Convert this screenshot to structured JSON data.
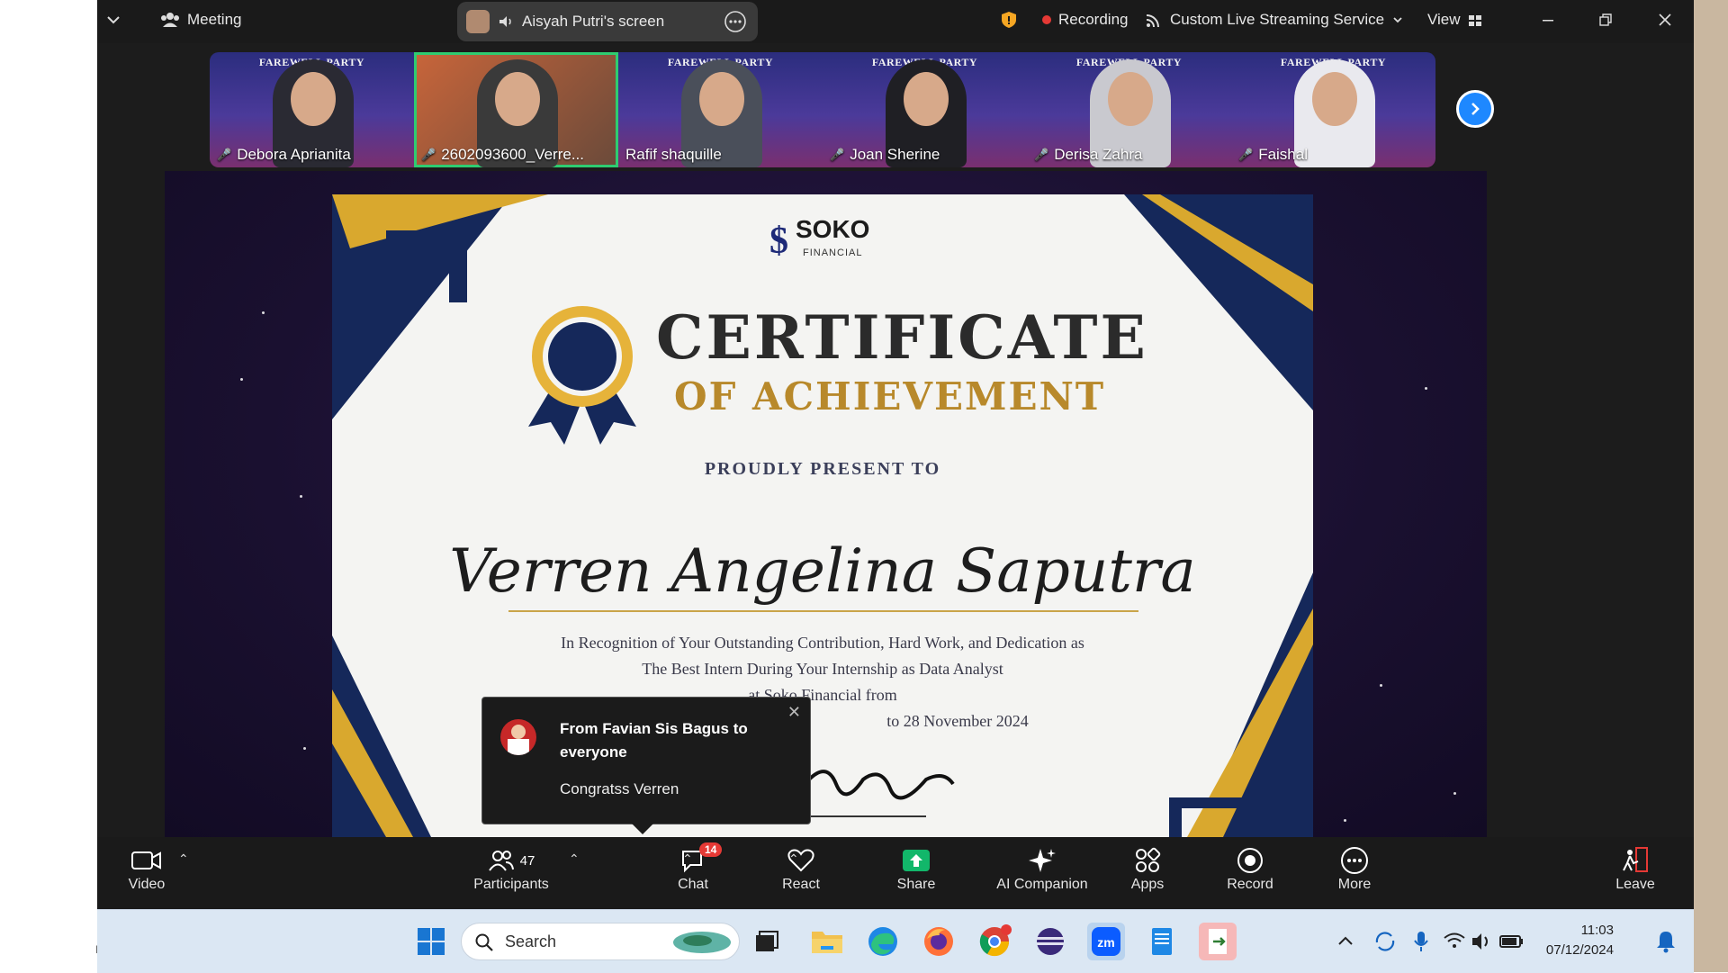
{
  "topbar": {
    "meeting_label": "Meeting",
    "screen_label": "Aisyah Putri's screen",
    "recording_label": "Recording",
    "streaming_label": "Custom Live Streaming Service",
    "view_label": "View"
  },
  "participants_strip": {
    "banner_text": "FAREWELL PARTY",
    "thumbs": [
      {
        "name": "Debora Aprianita"
      },
      {
        "name": "2602093600_Verre..."
      },
      {
        "name": "Rafif shaquille"
      },
      {
        "name": "Joan Sherine"
      },
      {
        "name": "Derisa Zahra"
      },
      {
        "name": "Faishal"
      }
    ]
  },
  "certificate": {
    "brand": "SOKO",
    "brand_sub": "FINANCIAL",
    "title": "CERTIFICATE",
    "subtitle": "OF ACHIEVEMENT",
    "present": "PROUDLY PRESENT TO",
    "recipient": "Verren Angelina Saputra",
    "body_line1": "In Recognition of Your Outstanding Contribution, Hard Work, and Dedication as",
    "body_line2": "The Best Intern During Your Internship as Data Analyst",
    "body_line3": "at Soko Financial from",
    "body_line4": "to 28 November 2024"
  },
  "toast": {
    "from": "From Favian Sis Bagus to everyone",
    "message": "Congratss Verren"
  },
  "toolbar": {
    "video": "Video",
    "participants": "Participants",
    "participants_count": "47",
    "chat": "Chat",
    "chat_badge": "14",
    "react": "React",
    "share": "Share",
    "ai": "AI Companion",
    "apps": "Apps",
    "record": "Record",
    "more": "More",
    "leave": "Leave"
  },
  "taskbar": {
    "search": "Search",
    "time": "11:03",
    "date": "07/12/2024",
    "left_fragment": "n"
  },
  "colors": {
    "accent_green": "#2ecc71",
    "share_green": "#12b76a",
    "record_red": "#e53935",
    "gold": "#b8892b",
    "navy": "#15285a"
  }
}
